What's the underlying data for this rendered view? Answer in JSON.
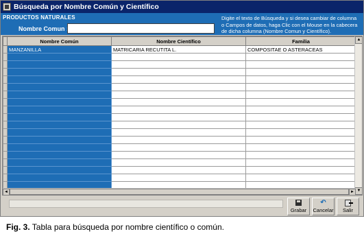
{
  "window": {
    "title": "Búsqueda por Nombre Común y Científico"
  },
  "search": {
    "section_title": "PRODUCTOS NATURALES",
    "field_label": "Nombre Comun :",
    "value": "",
    "help_text": "Digite el texto de Búsqueda y si desea cambiar de columna o Campos de datos, haga Clic con el Mouse en la cabecera de dicha columna (Nombre Comun y Científico)."
  },
  "grid": {
    "columns": [
      "Nombre Común",
      "Nombre Científico",
      "Familia"
    ],
    "rows": [
      [
        "MANZANILLA",
        "MATRICARIA RECUTITA L.",
        "COMPOSITAE O ASTERACEAS"
      ]
    ],
    "empty_row_count": 19,
    "highlight_color": "#1e6db5"
  },
  "buttons": {
    "save": "Grabar",
    "cancel": "Cancelar",
    "exit": "Salir"
  },
  "caption": {
    "label": "Fig. 3.",
    "text": "Tabla para búsqueda por nombre científico o común."
  }
}
